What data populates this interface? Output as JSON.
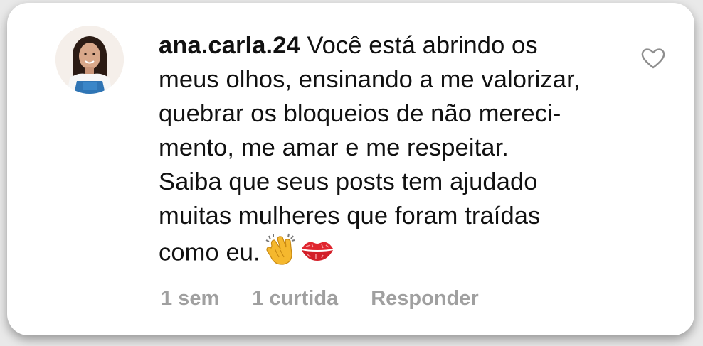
{
  "comment": {
    "username": "ana.carla.24",
    "lines": [
      " Você está abrindo os",
      "meus olhos, ensinando a me valorizar,",
      "quebrar os bloqueios de não mereci-",
      "mento, me amar e me respeitar.",
      "Saiba que seus posts tem ajudado",
      "muitas mulheres que foram traídas",
      "como eu."
    ],
    "emojis": [
      "clapping-hands",
      "kiss-mark"
    ]
  },
  "meta": {
    "time": "1 sem",
    "likes": "1 curtida",
    "reply": "Responder"
  },
  "icons": {
    "like": "heart-outline-icon"
  },
  "colors": {
    "text": "#111111",
    "meta": "#a0a0a0",
    "card": "#ffffff"
  }
}
